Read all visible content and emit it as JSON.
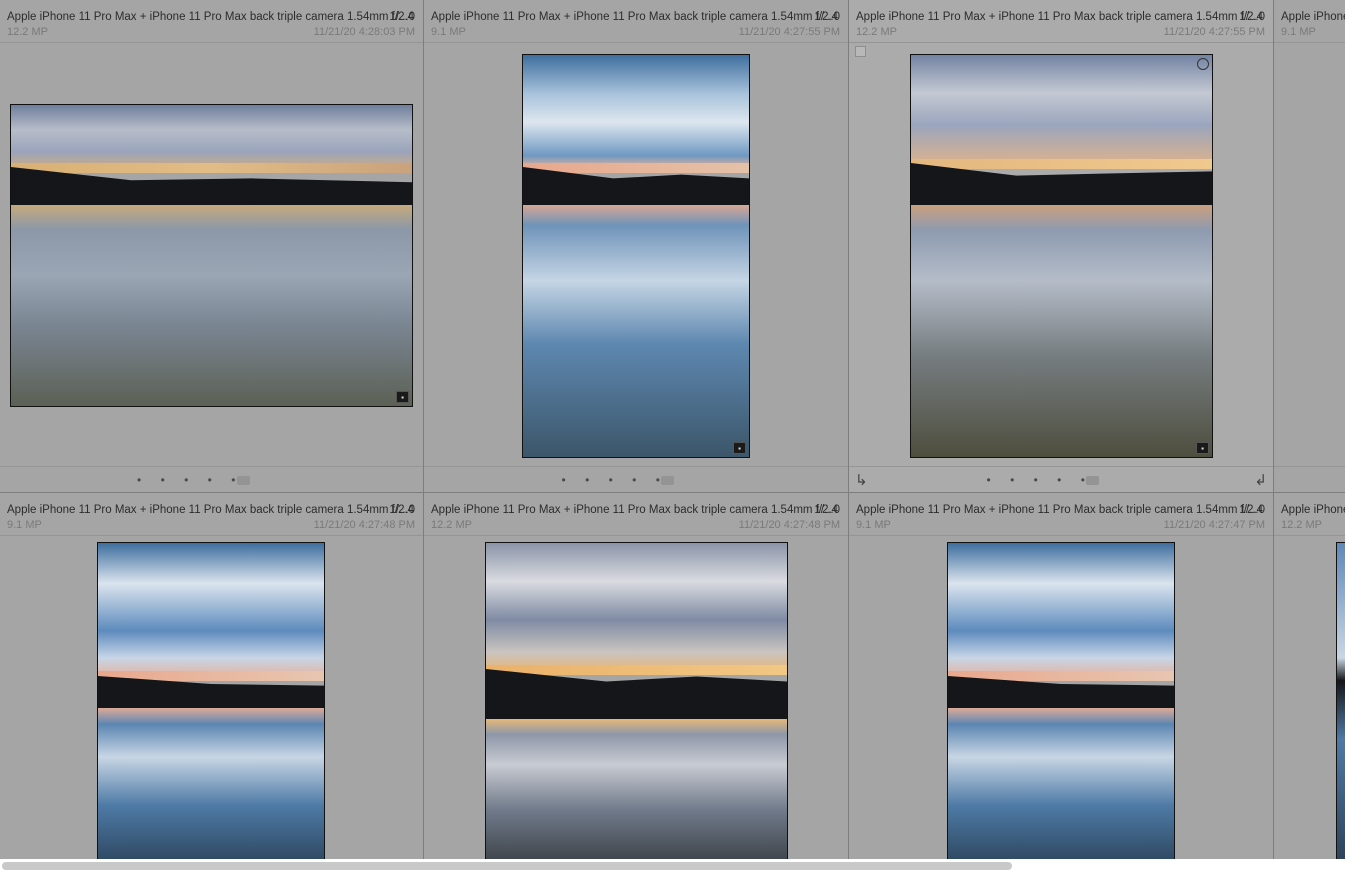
{
  "grid": {
    "row1": [
      {
        "camera": "Apple iPhone 11 Pro Max + iPhone 11 Pro Max back triple camera 1.54mm f/2.4",
        "shutter": "1/...0",
        "megapixels": "12.2 MP",
        "date": "11/21/20 4:28:03 PM"
      },
      {
        "camera": "Apple iPhone 11 Pro Max + iPhone 11 Pro Max back triple camera 1.54mm f/2.4",
        "shutter": "1/...0",
        "megapixels": "9.1 MP",
        "date": "11/21/20 4:27:55 PM"
      },
      {
        "camera": "Apple iPhone 11 Pro Max + iPhone 11 Pro Max back triple camera 1.54mm f/2.4",
        "shutter": "1/...0",
        "megapixels": "12.2 MP",
        "date": "11/21/20 4:27:55 PM"
      },
      {
        "camera": "Apple iPhone",
        "megapixels": "9.1 MP"
      }
    ],
    "row2": [
      {
        "camera": "Apple iPhone 11 Pro Max + iPhone 11 Pro Max back triple camera 1.54mm f/2.4",
        "shutter": "1/...0",
        "megapixels": "9.1 MP",
        "date": "11/21/20 4:27:48 PM"
      },
      {
        "camera": "Apple iPhone 11 Pro Max + iPhone 11 Pro Max back triple camera 1.54mm f/2.4",
        "shutter": "1/...0",
        "megapixels": "12.2 MP",
        "date": "11/21/20 4:27:48 PM"
      },
      {
        "camera": "Apple iPhone 11 Pro Max + iPhone 11 Pro Max back triple camera 1.54mm f/2.4",
        "shutter": "1/...0",
        "megapixels": "9.1 MP",
        "date": "11/21/20 4:27:47 PM"
      },
      {
        "camera": "Apple iPhone",
        "megapixels": "12.2 MP"
      }
    ]
  },
  "rating_dots": "• • • • •",
  "rotate_left_icon": "rotate-left-icon",
  "rotate_right_icon": "rotate-right-icon",
  "comment_badge_icon": "comment-badge-icon",
  "colors": {
    "cell_background": "#a5a5a5",
    "selected_cell_background": "#ababab",
    "divider": "#7d7d7d",
    "scrollbar_track": "#ffffff",
    "scrollbar_thumb": "#c9c9c9"
  }
}
